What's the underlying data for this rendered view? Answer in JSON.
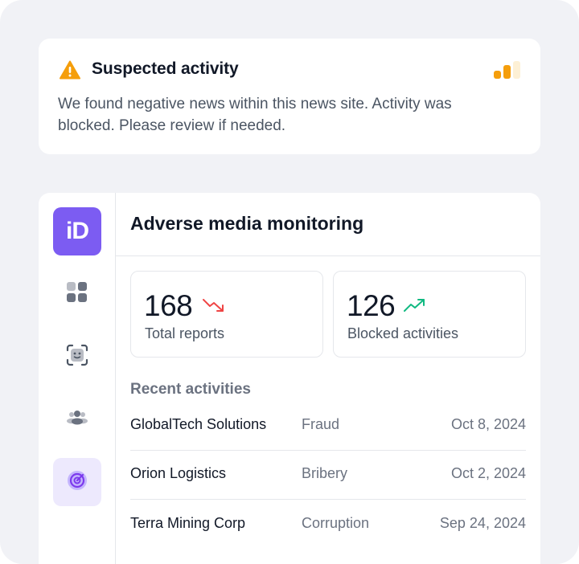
{
  "alert": {
    "title": "Suspected activity",
    "body": "We found negative news within this news site. Activity was blocked. Please review if needed.",
    "icon": "warning-triangle-icon",
    "accent": "#f59e0b"
  },
  "sidebar": {
    "logo_text": "iD",
    "brand_color": "#7c5cf2",
    "items": [
      {
        "icon": "dashboard-grid-icon"
      },
      {
        "icon": "face-scan-icon"
      },
      {
        "icon": "users-icon"
      },
      {
        "icon": "radar-icon",
        "active": true
      }
    ]
  },
  "main": {
    "title": "Adverse media monitoring",
    "stats": [
      {
        "value": "168",
        "label": "Total reports",
        "trend": "down",
        "trend_color": "#ef4444"
      },
      {
        "value": "126",
        "label": "Blocked activities",
        "trend": "up",
        "trend_color": "#10b981"
      }
    ],
    "recent_label": "Recent activities",
    "activities": [
      {
        "name": "GlobalTech Solutions",
        "type": "Fraud",
        "date": "Oct 8, 2024"
      },
      {
        "name": "Orion Logistics",
        "type": "Bribery",
        "date": "Oct 2, 2024"
      },
      {
        "name": "Terra Mining Corp",
        "type": "Corruption",
        "date": "Sep 24, 2024"
      }
    ]
  }
}
